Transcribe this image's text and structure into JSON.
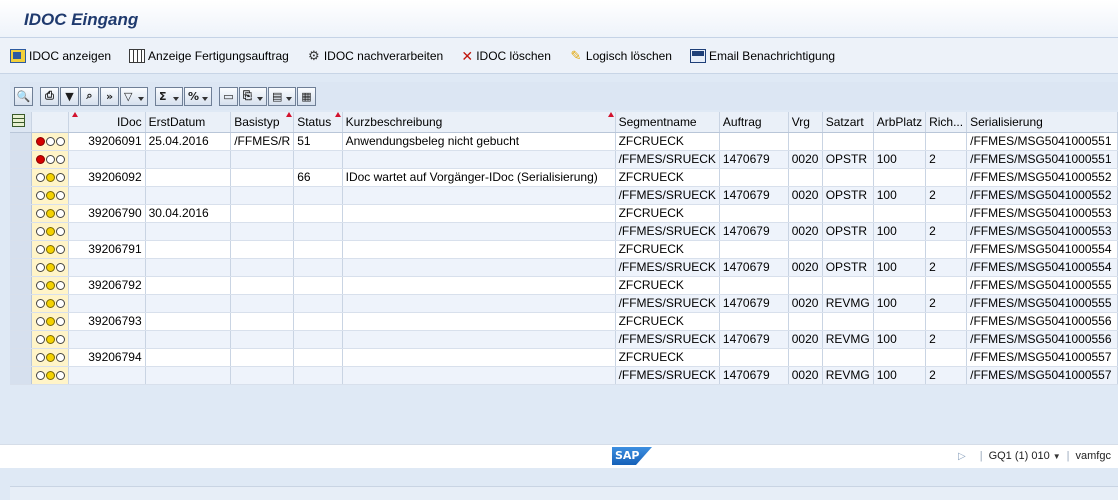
{
  "window": {
    "title": "IDOC Eingang"
  },
  "toolbar": {
    "buttons": [
      {
        "label": "IDOC anzeigen",
        "icon": "document-icon"
      },
      {
        "label": "Anzeige Fertigungsauftrag",
        "icon": "grid-icon"
      },
      {
        "label": "IDOC nachverarbeiten",
        "icon": "reprocess-icon"
      },
      {
        "label": "IDOC löschen",
        "icon": "delete-icon"
      },
      {
        "label": "Logisch löschen",
        "icon": "pencil-icon"
      },
      {
        "label": "Email Benachrichtigung",
        "icon": "mail-icon"
      }
    ]
  },
  "alv_toolbar": {
    "icons": [
      "details-icon",
      "print-icon",
      "filter-icon",
      "find-icon",
      "find-next-icon",
      "set-filter-icon",
      "sum-icon",
      "subtotal-icon",
      "print-preview-icon",
      "export-icon",
      "layout-icon",
      "grid-view-icon"
    ]
  },
  "table": {
    "columns": [
      "IDoc",
      "ErstDatum",
      "Basistyp",
      "Status",
      "Kurzbeschreibung",
      "Segmentname",
      "Auftrag",
      "Vrg",
      "Satzart",
      "ArbPlatz",
      "Rich...",
      "Serialisierung"
    ],
    "rows": [
      {
        "lights": "red",
        "idoc": "39206091",
        "erstdatum": "25.04.2016",
        "basistyp": "/FFMES/R",
        "status": "51",
        "kurz": "Anwendungsbeleg nicht gebucht",
        "segment": "ZFCRUECK",
        "auftrag": "",
        "vrg": "",
        "satzart": "",
        "arbplatz": "",
        "rich": "",
        "serial": "/FFMES/MSG5041000551"
      },
      {
        "lights": "red",
        "idoc": "",
        "erstdatum": "",
        "basistyp": "",
        "status": "",
        "kurz": "",
        "segment": "/FFMES/SRUECK",
        "auftrag": "1470679",
        "vrg": "0020",
        "satzart": "OPSTR",
        "arbplatz": "100",
        "rich": "2",
        "serial": "/FFMES/MSG5041000551"
      },
      {
        "lights": "yellow",
        "idoc": "39206092",
        "erstdatum": "",
        "basistyp": "",
        "status": "66",
        "kurz": "IDoc wartet auf Vorgänger-IDoc (Serialisierung)",
        "segment": "ZFCRUECK",
        "auftrag": "",
        "vrg": "",
        "satzart": "",
        "arbplatz": "",
        "rich": "",
        "serial": "/FFMES/MSG5041000552"
      },
      {
        "lights": "yellow",
        "idoc": "",
        "erstdatum": "",
        "basistyp": "",
        "status": "",
        "kurz": "",
        "segment": "/FFMES/SRUECK",
        "auftrag": "1470679",
        "vrg": "0020",
        "satzart": "OPSTR",
        "arbplatz": "100",
        "rich": "2",
        "serial": "/FFMES/MSG5041000552"
      },
      {
        "lights": "yellow",
        "idoc": "39206790",
        "erstdatum": "30.04.2016",
        "basistyp": "",
        "status": "",
        "kurz": "",
        "segment": "ZFCRUECK",
        "auftrag": "",
        "vrg": "",
        "satzart": "",
        "arbplatz": "",
        "rich": "",
        "serial": "/FFMES/MSG5041000553"
      },
      {
        "lights": "yellow",
        "idoc": "",
        "erstdatum": "",
        "basistyp": "",
        "status": "",
        "kurz": "",
        "segment": "/FFMES/SRUECK",
        "auftrag": "1470679",
        "vrg": "0020",
        "satzart": "OPSTR",
        "arbplatz": "100",
        "rich": "2",
        "serial": "/FFMES/MSG5041000553"
      },
      {
        "lights": "yellow",
        "idoc": "39206791",
        "erstdatum": "",
        "basistyp": "",
        "status": "",
        "kurz": "",
        "segment": "ZFCRUECK",
        "auftrag": "",
        "vrg": "",
        "satzart": "",
        "arbplatz": "",
        "rich": "",
        "serial": "/FFMES/MSG5041000554"
      },
      {
        "lights": "yellow",
        "idoc": "",
        "erstdatum": "",
        "basistyp": "",
        "status": "",
        "kurz": "",
        "segment": "/FFMES/SRUECK",
        "auftrag": "1470679",
        "vrg": "0020",
        "satzart": "OPSTR",
        "arbplatz": "100",
        "rich": "2",
        "serial": "/FFMES/MSG5041000554"
      },
      {
        "lights": "yellow",
        "idoc": "39206792",
        "erstdatum": "",
        "basistyp": "",
        "status": "",
        "kurz": "",
        "segment": "ZFCRUECK",
        "auftrag": "",
        "vrg": "",
        "satzart": "",
        "arbplatz": "",
        "rich": "",
        "serial": "/FFMES/MSG5041000555"
      },
      {
        "lights": "yellow",
        "idoc": "",
        "erstdatum": "",
        "basistyp": "",
        "status": "",
        "kurz": "",
        "segment": "/FFMES/SRUECK",
        "auftrag": "1470679",
        "vrg": "0020",
        "satzart": "REVMG",
        "arbplatz": "100",
        "rich": "2",
        "serial": "/FFMES/MSG5041000555"
      },
      {
        "lights": "yellow",
        "idoc": "39206793",
        "erstdatum": "",
        "basistyp": "",
        "status": "",
        "kurz": "",
        "segment": "ZFCRUECK",
        "auftrag": "",
        "vrg": "",
        "satzart": "",
        "arbplatz": "",
        "rich": "",
        "serial": "/FFMES/MSG5041000556"
      },
      {
        "lights": "yellow",
        "idoc": "",
        "erstdatum": "",
        "basistyp": "",
        "status": "",
        "kurz": "",
        "segment": "/FFMES/SRUECK",
        "auftrag": "1470679",
        "vrg": "0020",
        "satzart": "REVMG",
        "arbplatz": "100",
        "rich": "2",
        "serial": "/FFMES/MSG5041000556"
      },
      {
        "lights": "yellow",
        "idoc": "39206794",
        "erstdatum": "",
        "basistyp": "",
        "status": "",
        "kurz": "",
        "segment": "ZFCRUECK",
        "auftrag": "",
        "vrg": "",
        "satzart": "",
        "arbplatz": "",
        "rich": "",
        "serial": "/FFMES/MSG5041000557"
      },
      {
        "lights": "yellow",
        "idoc": "",
        "erstdatum": "",
        "basistyp": "",
        "status": "",
        "kurz": "",
        "segment": "/FFMES/SRUECK",
        "auftrag": "1470679",
        "vrg": "0020",
        "satzart": "REVMG",
        "arbplatz": "100",
        "rich": "2",
        "serial": "/FFMES/MSG5041000557"
      }
    ]
  },
  "status_bar": {
    "logo_text": "SAP",
    "system": "GQ1 (1) 010",
    "user": "vamfgc"
  },
  "colors": {
    "accent": "#1f3a6e",
    "status_highlight": "#fff4c8",
    "error_light": "#d40000",
    "warning_light": "#f4d200"
  }
}
